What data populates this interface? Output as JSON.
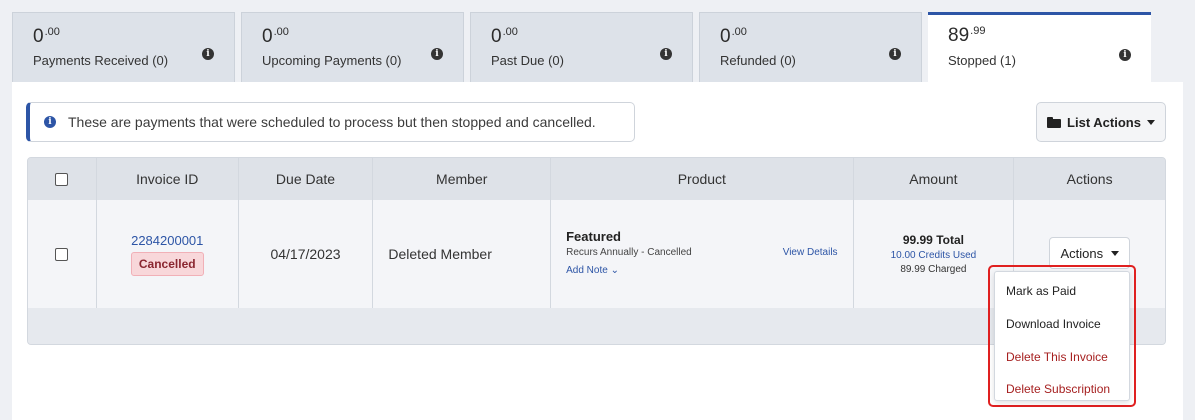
{
  "tabs": [
    {
      "whole": "0",
      "cents": ".00",
      "label": "Payments Received (0)"
    },
    {
      "whole": "0",
      "cents": ".00",
      "label": "Upcoming Payments (0)"
    },
    {
      "whole": "0",
      "cents": ".00",
      "label": "Past Due (0)"
    },
    {
      "whole": "0",
      "cents": ".00",
      "label": "Refunded (0)"
    },
    {
      "whole": "89",
      "cents": ".99",
      "label": "Stopped (1)"
    }
  ],
  "active_tab": "Stopped (1)",
  "notice": {
    "text": "These are payments that were scheduled to process but then stopped and cancelled."
  },
  "list_actions": {
    "label": "List Actions"
  },
  "table": {
    "headers": [
      "Invoice ID",
      "Due Date",
      "Member",
      "Product",
      "Amount",
      "Actions"
    ],
    "rows": [
      {
        "invoice_id": "2284200001",
        "status": "Cancelled",
        "due_date": "04/17/2023",
        "member": "Deleted Member",
        "product_name": "Featured",
        "product_recurrence": "Recurs Annually - Cancelled",
        "add_note": "Add Note",
        "view_details": "View Details",
        "amount_total": "99.99 Total",
        "amount_credits": "10.00 Credits Used",
        "amount_charged": "89.99 Charged",
        "actions_label": "Actions"
      }
    ]
  },
  "dropdown": {
    "items": [
      {
        "label": "Mark as Paid",
        "style": "normal"
      },
      {
        "label": "Download Invoice",
        "style": "normal"
      },
      {
        "label": "Delete This Invoice",
        "style": "danger"
      },
      {
        "label": "Delete Subscription",
        "style": "danger"
      }
    ]
  },
  "colors": {
    "accent": "#2d55a6",
    "danger": "#a62020",
    "highlight": "#e02020"
  }
}
